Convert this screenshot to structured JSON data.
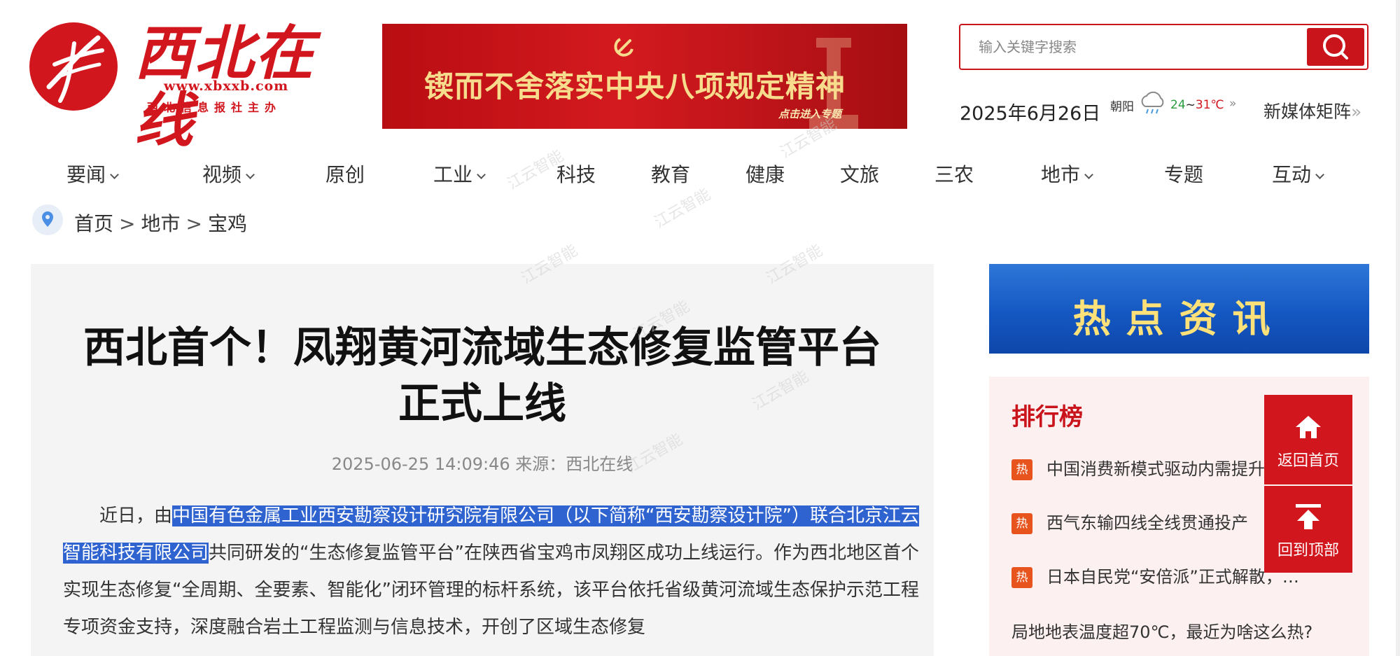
{
  "header": {
    "logo_name": "西北在线",
    "logo_url": "www.xbxxb.com",
    "logo_sub": "西北信息报社主办",
    "banner_text": "锲而不舍落实中央八项规定精神",
    "banner_tag": "点击进入专题",
    "search_placeholder": "输入关键字搜索",
    "date": "2025年6月26日",
    "weather_city": "朝阳",
    "weather_low": "24",
    "weather_sep": "~",
    "weather_high": "31℃",
    "weather_more": "»",
    "media_label": "新媒体矩阵",
    "media_arrow": "»"
  },
  "nav": {
    "items": [
      {
        "label": "要闻"
      },
      {
        "label": "视频"
      },
      {
        "label": "原创"
      },
      {
        "label": "工业"
      },
      {
        "label": "科技"
      },
      {
        "label": "教育"
      },
      {
        "label": "健康"
      },
      {
        "label": "文旅"
      },
      {
        "label": "三农"
      },
      {
        "label": "地市"
      },
      {
        "label": "专题"
      },
      {
        "label": "互动"
      }
    ]
  },
  "breadcrumb": {
    "home": "首页",
    "sep": ">",
    "level1": "地市",
    "level2": "宝鸡"
  },
  "article": {
    "title_line1": "西北首个！凤翔黄河流域生态修复监管平台",
    "title_line2": "正式上线",
    "meta": "2025-06-25 14:09:46 来源：西北在线",
    "para_lead": "近日，由",
    "para_hl1": "中国有色金属工业西安勘察设计研究院有限公司（以下简称“西安勘察设计院”）联合",
    "para_hl2": "北京江云智能科技有限公司",
    "para_rest1": "共同研发的“生态修复监管平台”在陕西省宝鸡市凤翔区成功上线运行。",
    "para_rest2": "作为西北地区首个实现生态修复“全周期、全要素、智能化”闭环管理的标杆系统，该平台依托省级",
    "para_rest3": "黄河流域生态保护示范工程专项资金支持，深度融合岩土工程监测与信息技术，开创了区域生态修复"
  },
  "sidebar": {
    "hot_banner": "热点资讯",
    "rank_title": "排行榜",
    "hot_badge": "热",
    "rank_items": [
      {
        "text": "中国消费新模式驱动内需提升"
      },
      {
        "text": "西气东输四线全线贯通投产"
      },
      {
        "text": "日本自民党“安倍派”正式解散，…"
      },
      {
        "text": "局地地表温度超70℃，最近为啥这么热?"
      }
    ],
    "float_home": "返回首页",
    "float_top": "回到顶部"
  },
  "watermark": "江云智能"
}
